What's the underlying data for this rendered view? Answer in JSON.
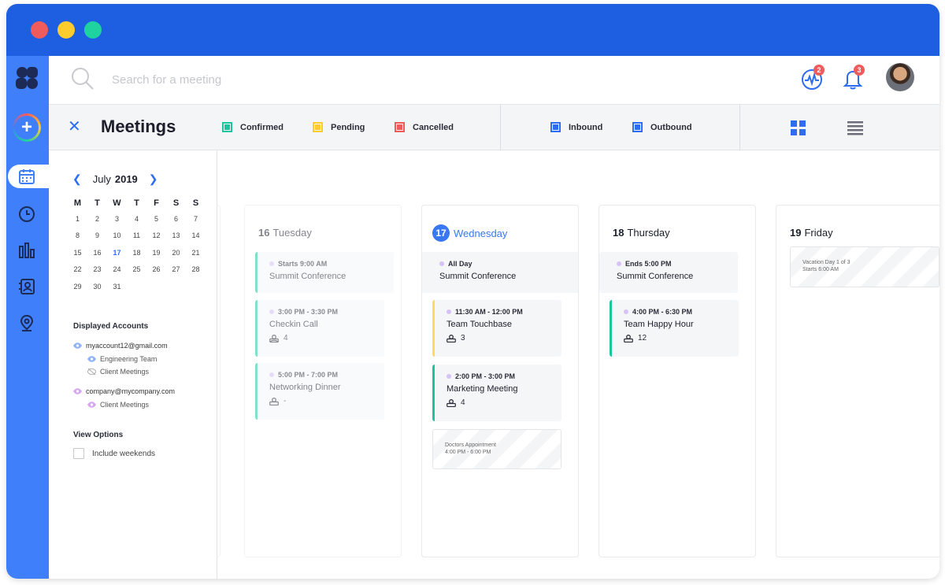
{
  "topbar": {
    "search_placeholder": "Search for a meeting",
    "activity_badge": "2",
    "notifications_badge": "3"
  },
  "subbar": {
    "title": "Meetings",
    "legend": [
      {
        "label": "Confirmed",
        "color": "#1bc5a0"
      },
      {
        "label": "Pending",
        "color": "#ffcc2e"
      },
      {
        "label": "Cancelled",
        "color": "#f05b5b"
      },
      {
        "label": "Inbound",
        "color": "#2f6df0"
      },
      {
        "label": "Outbound",
        "color": "#2f6df0"
      }
    ]
  },
  "sidebar": {
    "month": "July",
    "year": "2019",
    "weekdays": [
      "M",
      "T",
      "W",
      "T",
      "F",
      "S",
      "S"
    ],
    "weeks": [
      [
        "1",
        "2",
        "3",
        "4",
        "5",
        "6",
        "7"
      ],
      [
        "8",
        "9",
        "10",
        "11",
        "12",
        "13",
        "14"
      ],
      [
        "15",
        "16",
        "17",
        "18",
        "19",
        "20",
        "21"
      ],
      [
        "22",
        "23",
        "24",
        "25",
        "26",
        "27",
        "28"
      ],
      [
        "29",
        "30",
        "31",
        "",
        "",
        "",
        ""
      ]
    ],
    "today": "17",
    "displayed_accounts_title": "Displayed Accounts",
    "accounts": [
      {
        "email": "myaccount12@gmail.com",
        "color": "#8fb3f5",
        "calendars": [
          "Engineering Team",
          "Client Meetings"
        ]
      },
      {
        "email": "company@mycompany.com",
        "color": "#d7a8f0",
        "calendars": [
          "Client Meetings"
        ]
      }
    ],
    "view_options_title": "View Options",
    "include_weekends": "Include weekends"
  },
  "days": [
    {
      "num": "16",
      "name": "Tuesday",
      "events": [
        {
          "time": "Starts 9:00 AM",
          "name": "Summit Conference"
        },
        {
          "time": "3:00 PM - 3:30 PM",
          "name": "Checkin Call",
          "count": "4"
        },
        {
          "time": "5:00 PM - 7:00 PM",
          "name": "Networking Dinner",
          "count": "-"
        }
      ]
    },
    {
      "num": "17",
      "name": "Wednesday",
      "events": [
        {
          "time": "All Day",
          "name": "Summit Conference"
        },
        {
          "time": "11:30 AM - 12:00 PM",
          "name": "Team Touchbase",
          "count": "3"
        },
        {
          "time": "2:00 PM - 3:00 PM",
          "name": "Marketing Meeting",
          "count": "4"
        },
        {
          "line1": "Doctors Appointment",
          "line2": "4:00 PM - 6:00 PM"
        }
      ]
    },
    {
      "num": "18",
      "name": "Thursday",
      "events": [
        {
          "time": "Ends 5:00 PM",
          "name": "Summit Conference"
        },
        {
          "time": "4:00 PM - 6:30 PM",
          "name": "Team Happy Hour",
          "count": "12"
        }
      ]
    },
    {
      "num": "19",
      "name": "Friday",
      "events": [
        {
          "line1": "Vacation Day 1 of 3",
          "line2": "Starts 6:00 AM"
        }
      ]
    }
  ],
  "colors": {
    "brand": "#1e5ee0",
    "rail": "#3f7ffa",
    "accent": "#2f6df0"
  }
}
